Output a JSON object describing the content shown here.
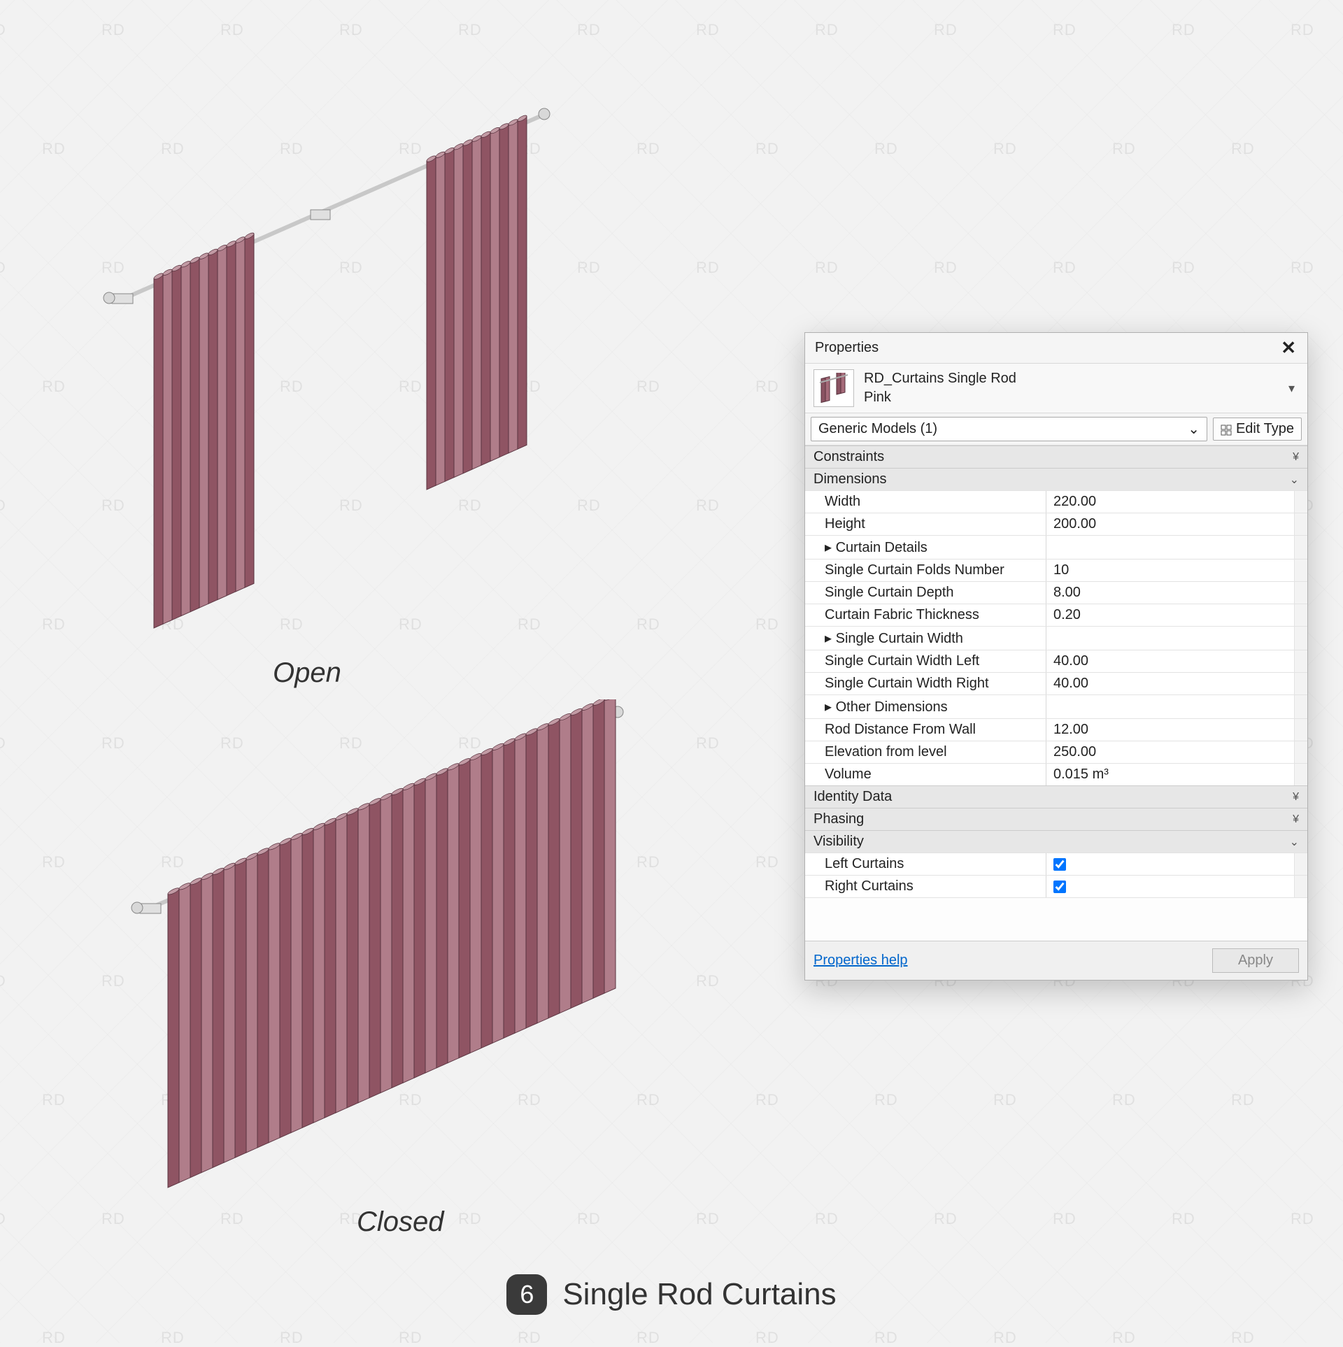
{
  "watermark": "RD",
  "viewport": {
    "open_label": "Open",
    "closed_label": "Closed"
  },
  "title": {
    "badge": "6",
    "text": "Single Rod Curtains"
  },
  "panel": {
    "title": "Properties",
    "type": {
      "name": "RD_Curtains Single Rod",
      "variant": "Pink"
    },
    "selector": "Generic Models (1)",
    "edit_type": "Edit Type",
    "groups": {
      "constraints": "Constraints",
      "dimensions": "Dimensions",
      "curtain_details": "Curtain Details",
      "single_curtain_width": "Single Curtain Width",
      "other_dimensions": "Other Dimensions",
      "identity_data": "Identity Data",
      "phasing": "Phasing",
      "visibility": "Visibility"
    },
    "props": {
      "width": {
        "label": "Width",
        "value": "220.00"
      },
      "height": {
        "label": "Height",
        "value": "200.00"
      },
      "folds": {
        "label": "Single Curtain Folds Number",
        "value": "10"
      },
      "depth": {
        "label": "Single Curtain Depth",
        "value": "8.00"
      },
      "thickness": {
        "label": "Curtain Fabric Thickness",
        "value": "0.20"
      },
      "scw_left": {
        "label": "Single Curtain Width Left",
        "value": "40.00"
      },
      "scw_right": {
        "label": "Single Curtain Width Right",
        "value": "40.00"
      },
      "rod_dist": {
        "label": "Rod Distance From Wall",
        "value": "12.00"
      },
      "elev": {
        "label": "Elevation from level",
        "value": "250.00"
      },
      "volume": {
        "label": "Volume",
        "value": "0.015 m³"
      },
      "left_c": {
        "label": "Left Curtains",
        "checked": true
      },
      "right_c": {
        "label": "Right Curtains",
        "checked": true
      }
    },
    "footer": {
      "help": "Properties help",
      "apply": "Apply"
    }
  }
}
